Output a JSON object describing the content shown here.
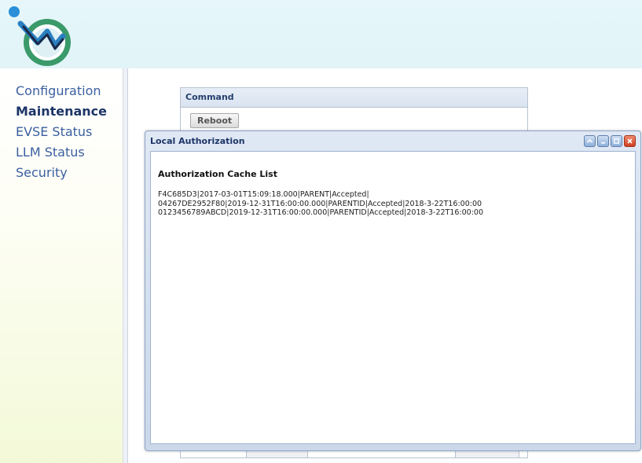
{
  "nav": {
    "items": [
      {
        "label": "Configuration",
        "active": false
      },
      {
        "label": "Maintenance",
        "active": true
      },
      {
        "label": "EVSE Status",
        "active": false
      },
      {
        "label": "LLM Status",
        "active": false
      },
      {
        "label": "Security",
        "active": false
      }
    ]
  },
  "command_panel": {
    "title": "Command",
    "reboot_label": "Reboot"
  },
  "dialog": {
    "title": "Local Authorization",
    "section_title": "Authorization Cache List",
    "entries": [
      "F4C685D3|2017-03-01T15:09:18.000|PARENT|Accepted|",
      "04267DE2952F80|2019-12-31T16:00:00.000|PARENTID|Accepted|2018-3-22T16:00:00",
      "0123456789ABCD|2019-12-31T16:00:00.000|PARENTID|Accepted|2018-3-22T16:00:00"
    ],
    "buttons": [
      "collapse-icon",
      "minimize-icon",
      "maximize-icon",
      "close-icon"
    ]
  },
  "colors": {
    "header_bg": "#e1f4f8",
    "nav_text": "#3b5fa0",
    "nav_active": "#1d3568",
    "dialog_title": "#1d3568"
  }
}
